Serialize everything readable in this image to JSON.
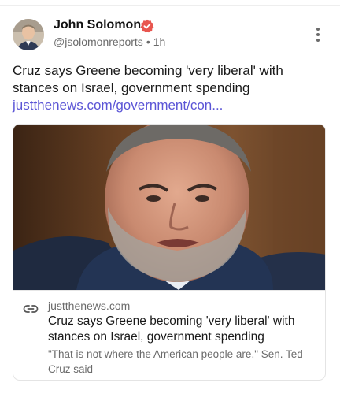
{
  "author": {
    "name": "John Solomon",
    "handle": "@jsolomonreports",
    "separator": "•",
    "time": "1h",
    "avatar_icon": "avatar-photo",
    "badge_icon": "verified-badge-icon",
    "badge_color": "#e8564f"
  },
  "post": {
    "text": "Cruz says Greene becoming 'very liberal' with stances on Israel, government spending ",
    "link_text": "justthenews.com/government/con...",
    "link_color": "#5b55d6"
  },
  "menu": {
    "icon": "more-vertical-icon"
  },
  "card": {
    "domain": "justthenews.com",
    "title": "Cruz says Greene becoming 'very liberal' with stances on Israel, government spending",
    "description": "\"That is not where the American people are,\" Sen. Ted Cruz said",
    "icon": "link-icon"
  }
}
